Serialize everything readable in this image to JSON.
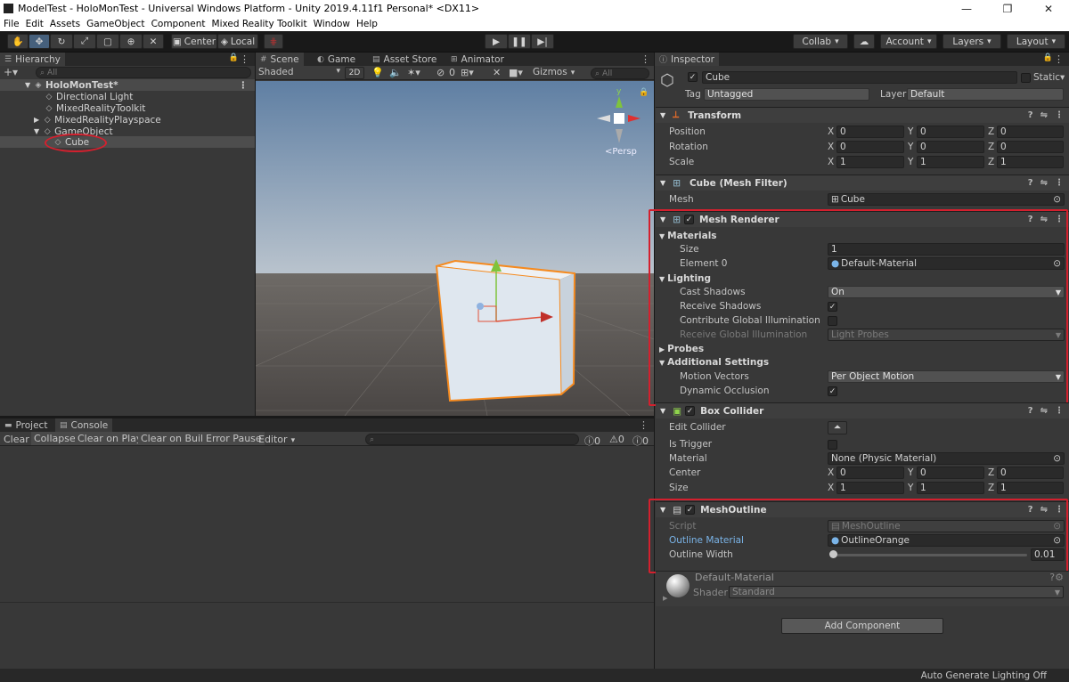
{
  "title": "ModelTest - HoloMonTest - Universal Windows Platform - Unity 2019.4.11f1 Personal* <DX11>",
  "menu": [
    "File",
    "Edit",
    "Assets",
    "GameObject",
    "Component",
    "Mixed Reality Toolkit",
    "Window",
    "Help"
  ],
  "toolbar": {
    "center": "Center",
    "local": "Local",
    "collab": "Collab",
    "account": "Account",
    "layers": "Layers",
    "layout": "Layout"
  },
  "hierarchy": {
    "tab": "Hierarchy",
    "search_placeholder": "All",
    "scene": "HoloMonTest*",
    "items": [
      "Directional Light",
      "MixedRealityToolkit",
      "MixedRealityPlayspace",
      "GameObject",
      "Cube"
    ]
  },
  "scene": {
    "tabs": [
      "Scene",
      "Game",
      "Asset Store",
      "Animator"
    ],
    "shading": "Shaded",
    "mode2d": "2D",
    "fx_count": "0",
    "gizmos": "Gizmos",
    "search": "All",
    "persp": "Persp",
    "axis_y": "y"
  },
  "console": {
    "tabs": [
      "Project",
      "Console"
    ],
    "buttons": [
      "Clear",
      "Collapse",
      "Clear on Play",
      "Clear on Build",
      "Error Pause",
      "Editor"
    ],
    "counts": [
      "0",
      "0",
      "0"
    ]
  },
  "inspector": {
    "tab": "Inspector",
    "name": "Cube",
    "static": "Static",
    "tag_label": "Tag",
    "tag": "Untagged",
    "layer_label": "Layer",
    "layer": "Default",
    "transform": {
      "title": "Transform",
      "rows": [
        {
          "label": "Position",
          "x": "0",
          "y": "0",
          "z": "0"
        },
        {
          "label": "Rotation",
          "x": "0",
          "y": "0",
          "z": "0"
        },
        {
          "label": "Scale",
          "x": "1",
          "y": "1",
          "z": "1"
        }
      ]
    },
    "axes": [
      "X",
      "Y",
      "Z"
    ],
    "meshfilter": {
      "title": "Cube (Mesh Filter)",
      "label": "Mesh",
      "value": "Cube"
    },
    "renderer": {
      "title": "Mesh Renderer",
      "materials": "Materials",
      "size_label": "Size",
      "size": "1",
      "element_label": "Element 0",
      "element": "Default-Material",
      "lighting": "Lighting",
      "cast_label": "Cast Shadows",
      "cast": "On",
      "receive_label": "Receive Shadows",
      "contrib_label": "Contribute Global Illumination",
      "receivegi_label": "Receive Global Illumination",
      "receivegi": "Light Probes",
      "probes": "Probes",
      "additional": "Additional Settings",
      "motion_label": "Motion Vectors",
      "motion": "Per Object Motion",
      "dynocc_label": "Dynamic Occlusion"
    },
    "collider": {
      "title": "Box Collider",
      "edit_label": "Edit Collider",
      "trigger_label": "Is Trigger",
      "material_label": "Material",
      "material": "None (Physic Material)",
      "center_label": "Center",
      "center": {
        "x": "0",
        "y": "0",
        "z": "0"
      },
      "size_label": "Size",
      "size": {
        "x": "1",
        "y": "1",
        "z": "1"
      }
    },
    "outline": {
      "title": "MeshOutline",
      "script_label": "Script",
      "script": "MeshOutline",
      "material_label": "Outline Material",
      "material": "OutlineOrange",
      "width_label": "Outline Width",
      "width": "0.01",
      "width_level": 0.01
    },
    "material": {
      "name": "Default-Material",
      "shader_label": "Shader",
      "shader": "Standard"
    },
    "add_component": "Add Component"
  },
  "status": "Auto Generate Lighting Off",
  "colors": {
    "highlight": "#d4202e",
    "selection": "#2c5d87",
    "accent_orange": "#f58a1f"
  }
}
